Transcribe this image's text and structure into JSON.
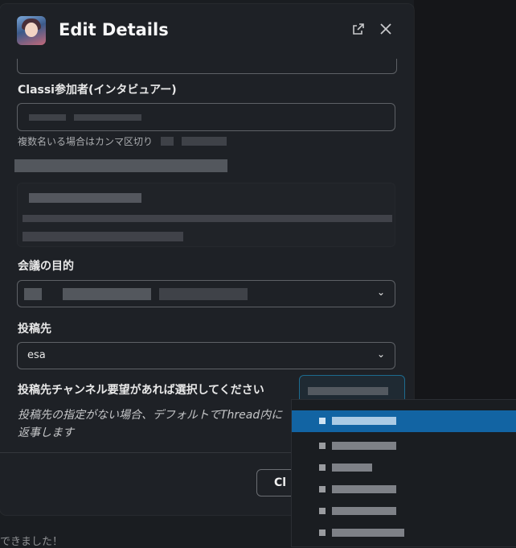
{
  "background": {
    "partial_text": "できました！"
  },
  "modal": {
    "title": "Edit Details",
    "open_external_icon": "external-link-icon",
    "close_icon": "close-icon",
    "fields": {
      "interviewer_label": "Classi参加者(インタビュアー)",
      "interviewer_hint": "複数名いる場合はカンマ区切り",
      "purpose_label": "会議の目的",
      "destination_label": "投稿先",
      "destination_value": "esa",
      "channel_label": "投稿先チャンネル要望があれば選択してください",
      "channel_note_line1": "投稿先の指定がない場合、デフォルトでThread内に",
      "channel_note_line2": "返事します"
    },
    "footer": {
      "close_button_label": "Cl"
    }
  },
  "colors": {
    "accent": "#1264a3",
    "modal_bg": "#1e2126",
    "page_bg": "#1a1d21"
  }
}
